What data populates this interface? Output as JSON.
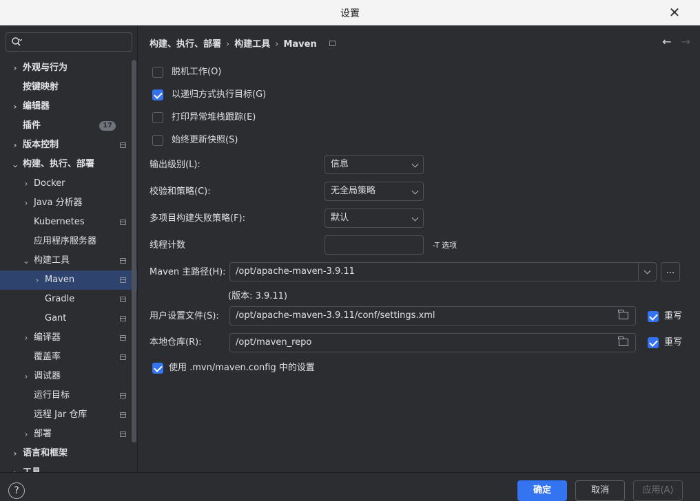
{
  "window": {
    "title": "设置"
  },
  "sidebar": {
    "search_placeholder": "",
    "items": [
      {
        "label": "外观与行为",
        "level": 0,
        "arrow": "›",
        "bold": true
      },
      {
        "label": "按键映射",
        "level": 0,
        "arrow": "",
        "bold": true
      },
      {
        "label": "编辑器",
        "level": 0,
        "arrow": "›",
        "bold": true
      },
      {
        "label": "插件",
        "level": 0,
        "arrow": "",
        "bold": true,
        "badge": "17"
      },
      {
        "label": "版本控制",
        "level": 0,
        "arrow": "›",
        "bold": true,
        "pin": true
      },
      {
        "label": "构建、执行、部署",
        "level": 0,
        "arrow": "⌄",
        "bold": true
      },
      {
        "label": "Docker",
        "level": 1,
        "arrow": "›"
      },
      {
        "label": "Java 分析器",
        "level": 1,
        "arrow": "›"
      },
      {
        "label": "Kubernetes",
        "level": 1,
        "arrow": "",
        "pin": true
      },
      {
        "label": "应用程序服务器",
        "level": 1,
        "arrow": ""
      },
      {
        "label": "构建工具",
        "level": 1,
        "arrow": "⌄",
        "pin": true
      },
      {
        "label": "Maven",
        "level": 2,
        "arrow": "›",
        "pin": true,
        "selected": true
      },
      {
        "label": "Gradle",
        "level": 2,
        "arrow": "",
        "pin": true
      },
      {
        "label": "Gant",
        "level": 2,
        "arrow": "",
        "pin": true
      },
      {
        "label": "编译器",
        "level": 1,
        "arrow": "›",
        "pin": true
      },
      {
        "label": "覆盖率",
        "level": 1,
        "arrow": "",
        "pin": true
      },
      {
        "label": "调试器",
        "level": 1,
        "arrow": "›"
      },
      {
        "label": "运行目标",
        "level": 1,
        "arrow": "",
        "pin": true
      },
      {
        "label": "远程 Jar 仓库",
        "level": 1,
        "arrow": "",
        "pin": true
      },
      {
        "label": "部署",
        "level": 1,
        "arrow": "›",
        "pin": true
      },
      {
        "label": "语言和框架",
        "level": 0,
        "arrow": "›",
        "bold": true
      },
      {
        "label": "工具",
        "level": 0,
        "arrow": "›",
        "bold": true
      }
    ]
  },
  "breadcrumb": [
    "构建、执行、部署",
    "构建工具",
    "Maven"
  ],
  "breadcrumb_sep": "›",
  "nav": {
    "back": "←",
    "forward": "→"
  },
  "options": {
    "offline": {
      "label": "脱机工作(O)",
      "checked": false
    },
    "recursive": {
      "label": "以递归方式执行目标(G)",
      "checked": true
    },
    "stacktrace": {
      "label": "打印异常堆栈跟踪(E)",
      "checked": false
    },
    "always_update": {
      "label": "始终更新快照(S)",
      "checked": false
    }
  },
  "fields": {
    "output_level": {
      "label": "输出级别(L):",
      "value": "信息"
    },
    "checksum": {
      "label": "校验和策略(C):",
      "value": "无全局策略"
    },
    "multiproject": {
      "label": "多项目构建失败策略(F):",
      "value": "默认"
    },
    "threads": {
      "label": "线程计数",
      "value": "",
      "hint": "-T 选项"
    },
    "maven_home": {
      "label": "Maven 主路径(H):",
      "value": "/opt/apache-maven-3.9.11",
      "version": "(版本: 3.9.11)",
      "browse": "..."
    },
    "user_settings": {
      "label": "用户设置文件(S):",
      "value": "/opt/apache-maven-3.9.11/conf/settings.xml",
      "override_label": "重写",
      "override": true
    },
    "local_repo": {
      "label": "本地仓库(R):",
      "value": "/opt/maven_repo",
      "override_label": "重写",
      "override": true
    }
  },
  "use_mvn_config": {
    "label": "使用 .mvn/maven.config 中的设置",
    "checked": true
  },
  "footer": {
    "help": "?",
    "ok": "确定",
    "cancel": "取消",
    "apply": "应用(A)"
  },
  "colors": {
    "accent": "#3574f0",
    "selection": "#2e436e",
    "background": "#2b2d30"
  }
}
